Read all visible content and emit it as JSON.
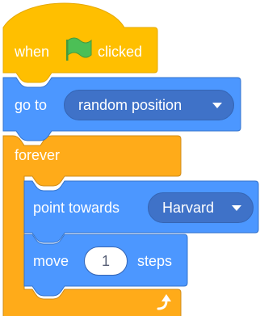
{
  "colors": {
    "events": "#ffbf00",
    "events_edge": "#e6a800",
    "motion": "#4c97ff",
    "motion_edge": "#3373cc",
    "control": "#ffab19",
    "control_edge": "#cf8b17",
    "flag": "#4cbf56",
    "reporter": "#3f72c8"
  },
  "script": {
    "hat": {
      "word_when": "when",
      "flag_icon": "green-flag",
      "word_clicked": "clicked"
    },
    "goto": {
      "label": "go to",
      "menu_value": "random position"
    },
    "forever": {
      "label": "forever",
      "loop_icon": "loop-arrow"
    },
    "point": {
      "label": "point towards",
      "menu_value": "Harvard"
    },
    "move": {
      "label": "move",
      "steps_value": "1",
      "unit": "steps"
    }
  }
}
